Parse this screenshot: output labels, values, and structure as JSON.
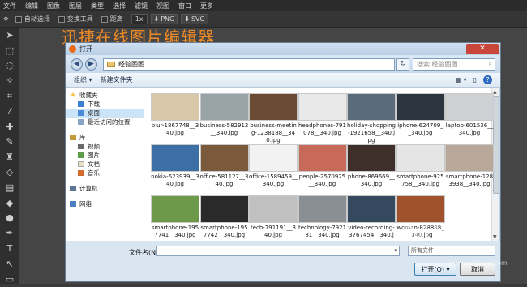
{
  "menu": [
    "文件",
    "编辑",
    "图像",
    "图层",
    "类型",
    "选择",
    "滤镜",
    "视图",
    "窗口",
    "更多"
  ],
  "options": {
    "auto_select": "自动选择",
    "transform": "变换工具",
    "distance": "距离",
    "zoom": "1x",
    "png": "PNG",
    "svg": "SVG"
  },
  "brand_title": "迅捷在线图片编辑器",
  "dialog": {
    "title": "打开",
    "close": "✕",
    "path": "经验图图",
    "search_placeholder": "搜索 经验图图",
    "organize": "组织 ▾",
    "new_folder": "新建文件夹",
    "nav": {
      "favorites": "收藏夹",
      "downloads": "下载",
      "desktop": "桌面",
      "recent": "最近访问的位置",
      "libraries": "库",
      "videos": "视频",
      "pictures": "图片",
      "documents": "文档",
      "music": "音乐",
      "computer": "计算机",
      "network": "网络"
    },
    "files": [
      {
        "name": "blur-1867748__340.jpg",
        "color": "#d8c7a8"
      },
      {
        "name": "business-582912__340.jpg",
        "color": "#9aa3a8"
      },
      {
        "name": "business-meeting-1238188__340.jpg",
        "color": "#6b4b34"
      },
      {
        "name": "headphones-791078__340.jpg",
        "color": "#e9e9e9"
      },
      {
        "name": "holiday-shopping-1921658__340.jpg",
        "color": "#5a6b7c"
      },
      {
        "name": "iphone-624709__340.jpg",
        "color": "#2d3540"
      },
      {
        "name": "laptop-601536__340.jpg",
        "color": "#cfd2d4"
      },
      {
        "name": "nokia-623939__340.jpg",
        "color": "#3b6fa6"
      },
      {
        "name": "office-581127__340.jpg",
        "color": "#7a5a3a"
      },
      {
        "name": "office-1589459__340.jpg",
        "color": "#f2f2f2"
      },
      {
        "name": "people-2570925__340.jpg",
        "color": "#c86a5a"
      },
      {
        "name": "phone-869669__340.jpg",
        "color": "#3f2f2a"
      },
      {
        "name": "smartphone-925758__340.jpg",
        "color": "#e5e5e5"
      },
      {
        "name": "smartphone-1283938__340.jpg",
        "color": "#b8a89a"
      },
      {
        "name": "smartphone-1957741__340.jpg",
        "color": "#6c9a4a"
      },
      {
        "name": "smartphone-1957742__340.jpg",
        "color": "#2a2a2a"
      },
      {
        "name": "tech-791191__340.jpg",
        "color": "#c0c0c0"
      },
      {
        "name": "technology-792181__340.jpg",
        "color": "#8a8f94"
      },
      {
        "name": "video-recording-3767454__340.jpg",
        "color": "#34495e"
      },
      {
        "name": "woman-828888__340.jpg",
        "color": "#a0522d"
      }
    ],
    "filename_label": "文件名(N):",
    "filetype": "所有文件",
    "open_button": "打开(O) ▾",
    "cancel_button": "取消"
  },
  "watermark": "Bai 经验",
  "watermark_sub": "jingyan.baidu.com"
}
